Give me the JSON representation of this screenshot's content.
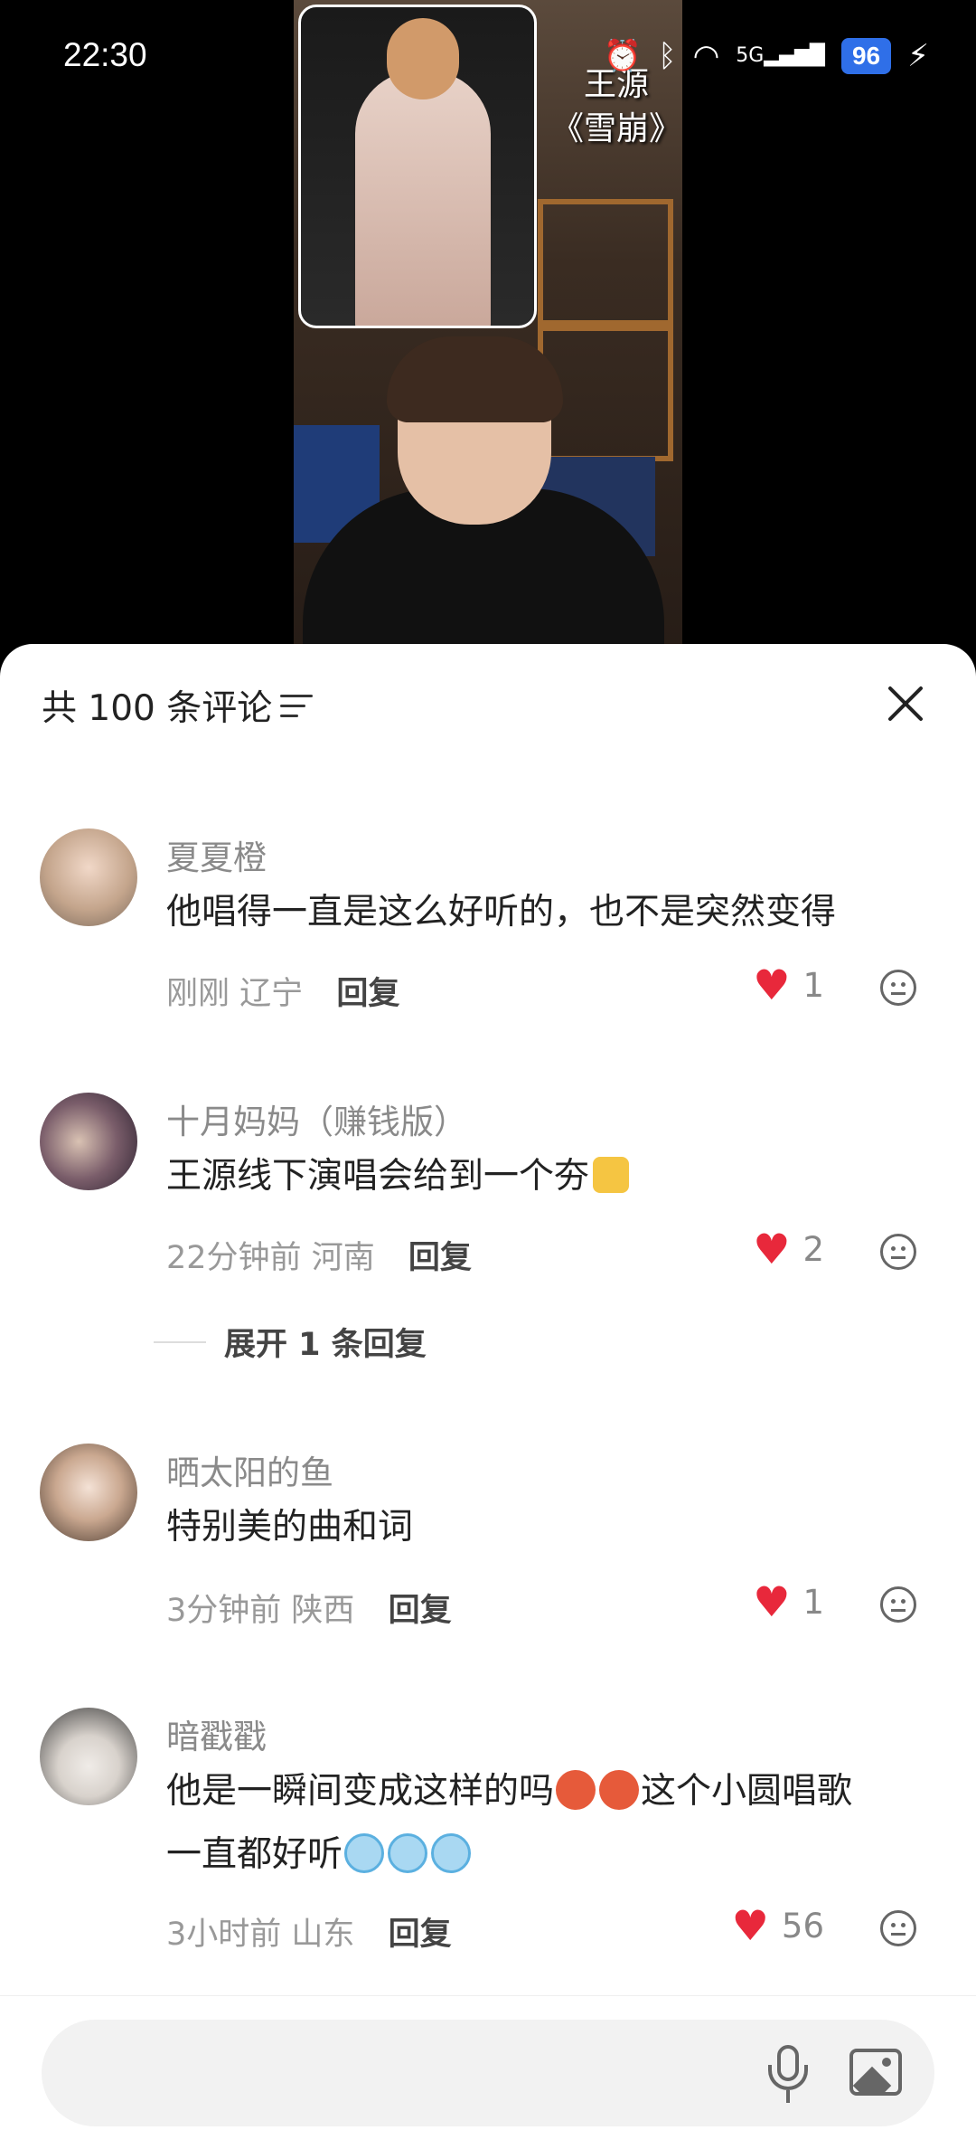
{
  "status_bar": {
    "time": "22:30",
    "network": "5G",
    "battery": "96",
    "icons": [
      "alarm-icon",
      "bluetooth-icon",
      "wifi-icon",
      "signal-icon",
      "battery-icon",
      "charging-icon"
    ]
  },
  "video": {
    "overlay_artist": "王源",
    "overlay_song": "《雪崩》"
  },
  "comments_panel": {
    "title": "共 100 条评论",
    "comments": [
      {
        "user": "夏夏橙",
        "text": "他唱得一直是这么好听的，也不是突然变得",
        "time": "刚刚",
        "location": "辽宁",
        "reply_label": "回复",
        "likes": "1"
      },
      {
        "user": "十月妈妈（赚钱版）",
        "text": "王源线下演唱会给到一个夯",
        "time": "22分钟前",
        "location": "河南",
        "reply_label": "回复",
        "likes": "2",
        "expand_replies": "展开 1 条回复"
      },
      {
        "user": "晒太阳的鱼",
        "text": "特别美的曲和词",
        "time": "3分钟前",
        "location": "陕西",
        "reply_label": "回复",
        "likes": "1"
      },
      {
        "user": "暗戳戳",
        "text_part1": "他是一瞬间变成这样的吗",
        "text_part2": "这个小圆唱歌",
        "text_part3": "一直都好听",
        "time": "3小时前",
        "location": "山东",
        "reply_label": "回复",
        "likes": "56"
      }
    ]
  },
  "input_bar": {
    "placeholder": ""
  },
  "colors": {
    "like_red": "#e8283b",
    "battery_blue": "#2f6fe8"
  }
}
